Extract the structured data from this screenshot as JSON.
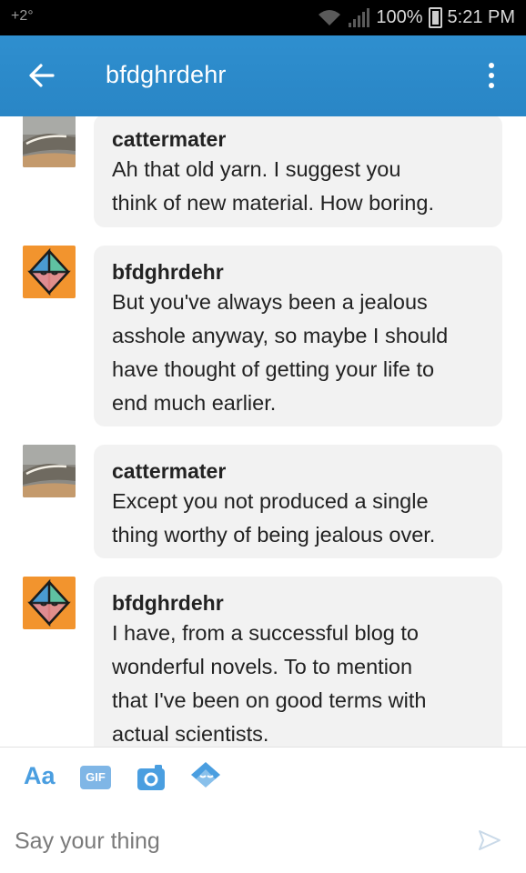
{
  "status_bar": {
    "left_text": "+2°",
    "battery": "100%",
    "time": "5:21 PM"
  },
  "header": {
    "title": "bfdghrdehr"
  },
  "messages": [
    {
      "sender": "cattermater",
      "lines": [
        "Ah that old yarn. I suggest you",
        "think of new material. How boring."
      ],
      "avatar": "landscape-avatar"
    },
    {
      "sender": "bfdghrdehr",
      "lines": [
        "But you've always been a jealous",
        "asshole anyway, so maybe I should",
        "have thought of getting your life to",
        "end much earlier."
      ],
      "avatar": "octahedron-avatar"
    },
    {
      "sender": "cattermater",
      "lines": [
        "Except you not produced a single",
        "thing worthy of being jealous over."
      ],
      "avatar": "landscape-avatar"
    },
    {
      "sender": "bfdghrdehr",
      "lines": [
        "I have, from a successful blog to",
        "wonderful novels. To to mention",
        "that I've been on good terms with",
        "actual scientists."
      ],
      "avatar": "octahedron-avatar"
    }
  ],
  "toolbar": {
    "text_format_label": "Aa",
    "gif_label": "GIF",
    "camera_icon": "camera-icon",
    "sticker_icon": "sticker-icon"
  },
  "composer": {
    "placeholder": "Say your thing",
    "value": "",
    "send_icon": "send-icon"
  },
  "colors": {
    "header_blue": "#2b89c9",
    "bubble_bg": "#f2f2f2",
    "accent": "#4a9ee0",
    "avatar_orange": "#f2942e"
  }
}
